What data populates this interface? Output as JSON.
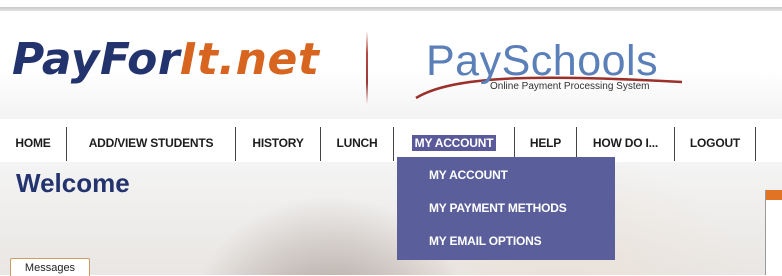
{
  "header": {
    "logo_left_part1": "PayFor",
    "logo_left_part2": "It.net",
    "logo_right": "PaySchools",
    "logo_right_tagline": "Online Payment Processing System"
  },
  "nav": {
    "items": [
      {
        "label": "HOME"
      },
      {
        "label": "ADD/VIEW STUDENTS"
      },
      {
        "label": "HISTORY"
      },
      {
        "label": "LUNCH"
      },
      {
        "label": "MY ACCOUNT",
        "active": true
      },
      {
        "label": "HELP"
      },
      {
        "label": "HOW DO I..."
      },
      {
        "label": "LOGOUT"
      }
    ]
  },
  "dropdown": {
    "items": [
      {
        "label": "MY ACCOUNT"
      },
      {
        "label": "MY PAYMENT METHODS"
      },
      {
        "label": "MY EMAIL OPTIONS"
      }
    ]
  },
  "main": {
    "title": "Welcome",
    "messages_tab": "Messages"
  },
  "colors": {
    "brand_navy": "#22336e",
    "brand_orange": "#d7641f",
    "menu_purple": "#5a5f9c",
    "payschools_blue": "#5b7fb8"
  }
}
